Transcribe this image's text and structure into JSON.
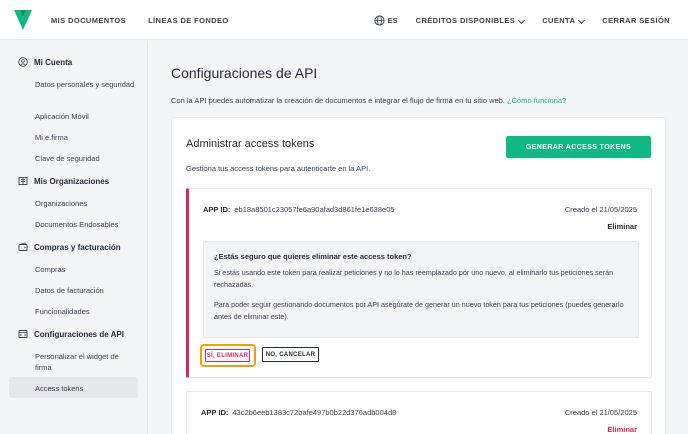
{
  "nav": {
    "left": [
      "MIS DOCUMENTOS",
      "LÍNEAS DE FONDEO"
    ],
    "lang": "ES",
    "credits": "CRÉDITOS DISPONIBLES",
    "account": "CUENTA",
    "logout": "CERRAR SESIÓN"
  },
  "sidebar": {
    "sections": [
      {
        "label": "Mi Cuenta",
        "icon": "user-circle-icon"
      },
      {
        "label": "Mis Organizaciones",
        "icon": "building-icon"
      },
      {
        "label": "Compras y facturación",
        "icon": "wallet-icon"
      },
      {
        "label": "Configuraciones de API",
        "icon": "api-window-icon"
      }
    ],
    "items": [
      "Datos personales y seguridad",
      "Aplicación Móvil",
      "Mi e.firma",
      "Clave de seguridad",
      "Organizaciones",
      "Documentos Endosables",
      "Compras",
      "Datos de facturación",
      "Funcionalidades",
      "Personalizar el widget de firma",
      "Access tokens"
    ]
  },
  "main": {
    "title": "Configuraciones de API",
    "intro": "Con la API puedes automatizar la creación de documentos e integrar el flujo de firma en tu sitio web.",
    "intro_link": "¿Cómo funciona?",
    "card": {
      "title": "Administrar access tokens",
      "subtitle": "Gestiona tus access tokens para autenticarte en la API.",
      "generate_button": "GENERAR ACCESS TOKENS",
      "tokens": [
        {
          "id_label": "APP ID:",
          "id": "eb18a8501c23057fe6a90afad3d861fe1e638e05",
          "created": "Creado el 21/05/2025",
          "delete": "Eliminar",
          "confirm": {
            "question": "¿Estás seguro que quieres eliminar este access token?",
            "p1": "Si estás usando este token para realizar peticiones y no lo has reemplazado por uno nuevo, al eliminarlo tus peticiones serán rechazadas.",
            "p2": "Para poder seguir gestionando documentos por API asegúrate de generar un nuevo token para tus peticiones (puedes generarlo antes de eliminar este).",
            "yes": "SÍ, ELIMINAR",
            "no": "NO, CANCELAR"
          }
        },
        {
          "id_label": "APP ID:",
          "id": "43c2b6eeb1383c72bafe497b0b22d376adb004d8",
          "created": "Creado el 21/05/2025",
          "delete": "Eliminar"
        }
      ]
    }
  },
  "colors": {
    "accent": "#10b981",
    "danger": "#dc2657",
    "highlight": "#f59e0b"
  }
}
